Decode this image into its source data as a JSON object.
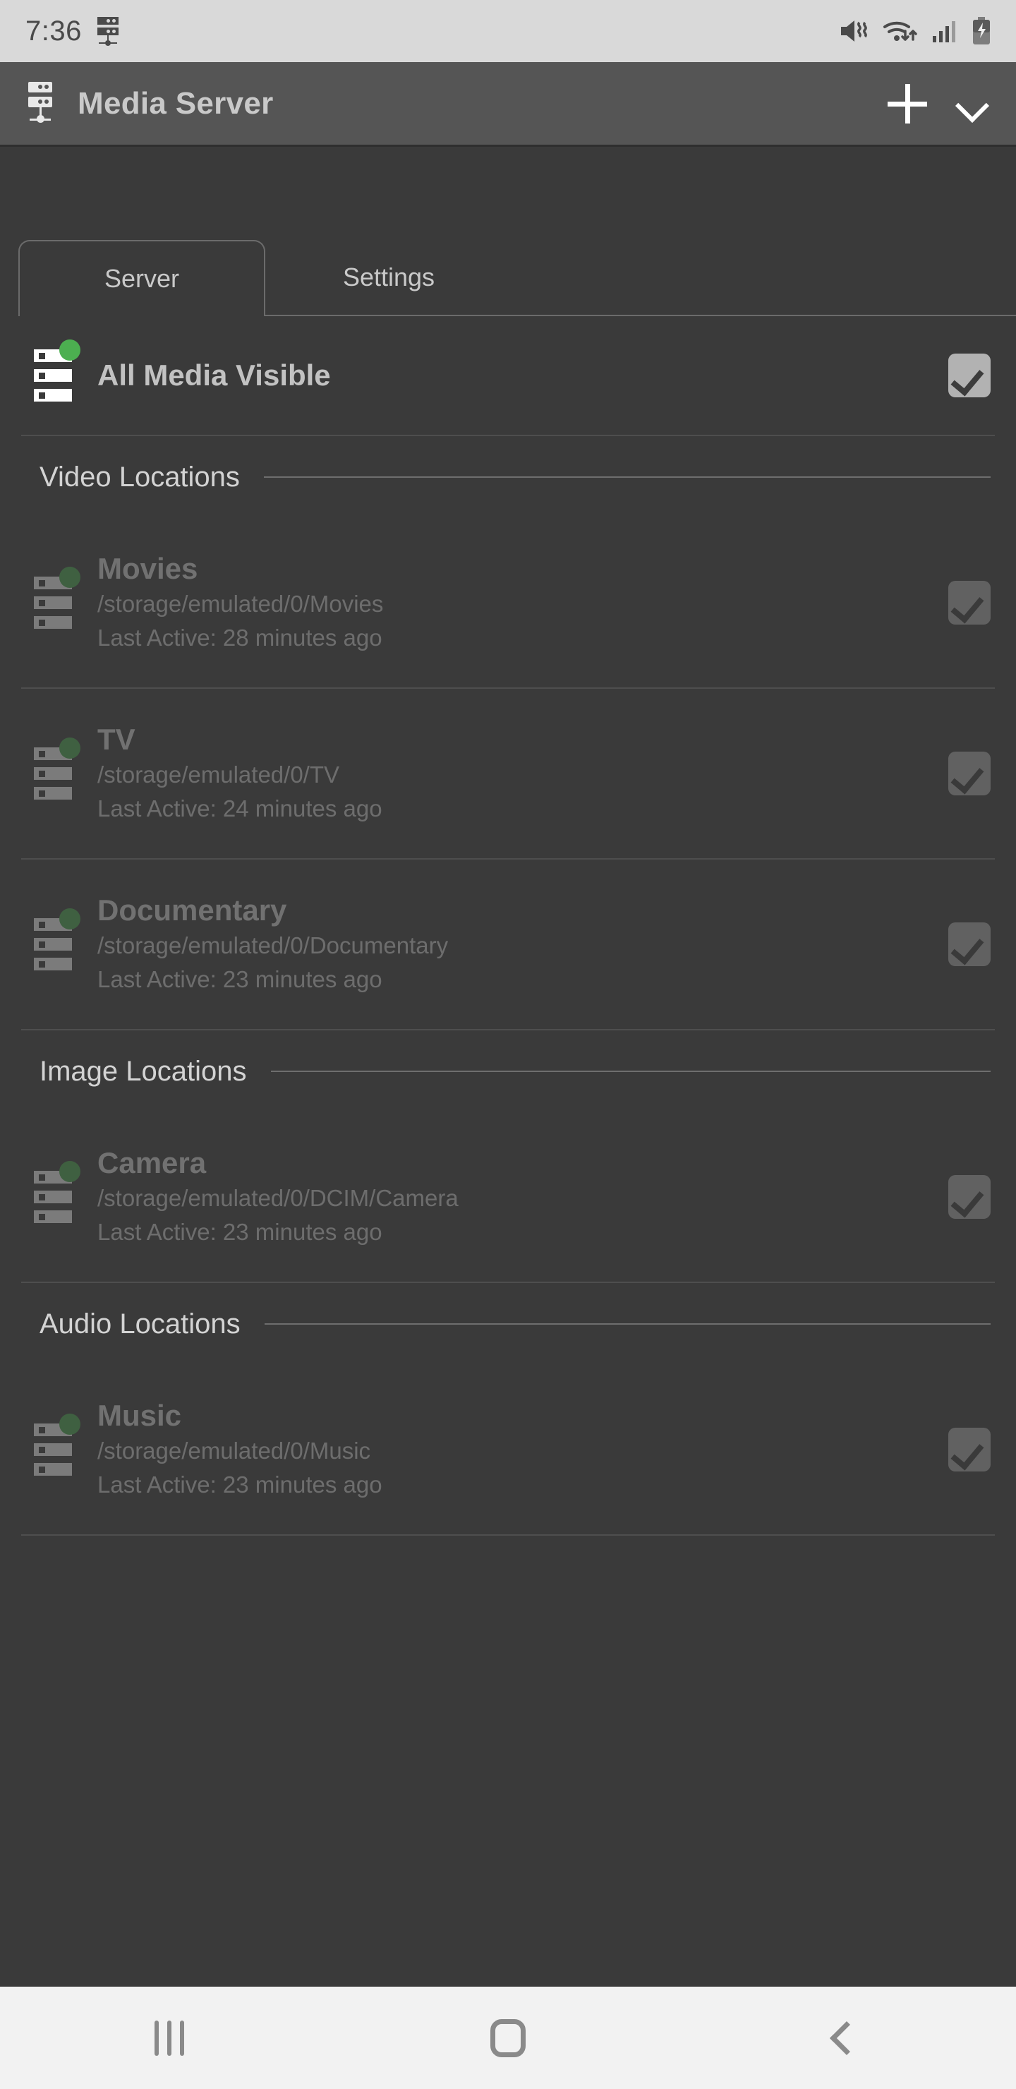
{
  "status_bar": {
    "clock": "7:36",
    "left_icons": [
      "server-notification-icon"
    ],
    "right_icons": [
      "mute-vibrate-icon",
      "wifi-icon",
      "cellular-signal-icon",
      "battery-charging-icon"
    ]
  },
  "app_bar": {
    "icon": "server-icon",
    "title": "Media Server",
    "add_label": "+",
    "dropdown_label": "chevron-down-icon"
  },
  "tabs": [
    {
      "label": "Server",
      "active": true
    },
    {
      "label": "Settings",
      "active": false
    }
  ],
  "master_toggle": {
    "label": "All Media Visible",
    "checked": true,
    "icon": "server-icon",
    "status_dot_color": "#4caf50"
  },
  "sections": [
    {
      "title": "Video Locations",
      "items": [
        {
          "name": "Movies",
          "path": "/storage/emulated/0/Movies",
          "last_active": "Last Active: 28 minutes ago",
          "checked": true
        },
        {
          "name": "TV",
          "path": "/storage/emulated/0/TV",
          "last_active": "Last Active: 24 minutes ago",
          "checked": true
        },
        {
          "name": "Documentary",
          "path": "/storage/emulated/0/Documentary",
          "last_active": "Last Active: 23 minutes ago",
          "checked": true
        }
      ]
    },
    {
      "title": "Image Locations",
      "items": [
        {
          "name": "Camera",
          "path": "/storage/emulated/0/DCIM/Camera",
          "last_active": "Last Active: 23 minutes ago",
          "checked": true
        }
      ]
    },
    {
      "title": "Audio Locations",
      "items": [
        {
          "name": "Music",
          "path": "/storage/emulated/0/Music",
          "last_active": "Last Active: 23 minutes ago",
          "checked": true
        }
      ]
    }
  ],
  "nav_bar": {
    "recents": "recents-icon",
    "home": "home-icon",
    "back": "back-icon"
  },
  "colors": {
    "background": "#3a3a3a",
    "app_bar": "#555555",
    "status_bar": "#d9d9d9",
    "accent_green": "#4caf50",
    "checkbox": "#b2b2b2",
    "nav_bar": "#f2f2f2"
  }
}
